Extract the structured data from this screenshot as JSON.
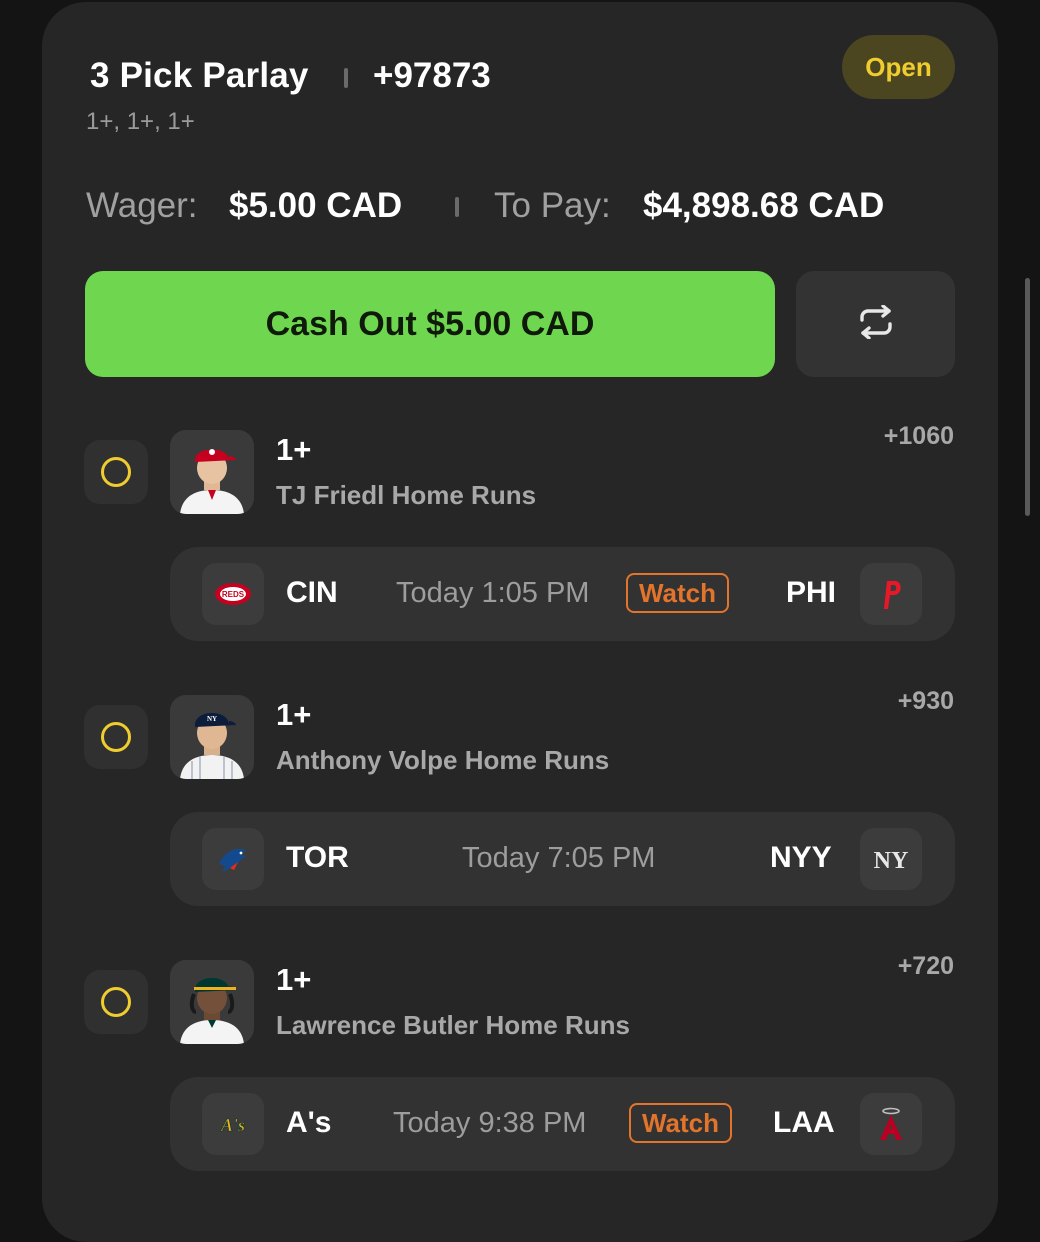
{
  "bet": {
    "title": "3 Pick Parlay",
    "odds": "+97873",
    "subtitle": "1+, 1+, 1+",
    "status": "Open",
    "wager_label": "Wager:",
    "wager_value": "$5.00 CAD",
    "pay_label": "To Pay:",
    "pay_value": "$4,898.68 CAD",
    "cashout_label": "Cash Out $5.00 CAD",
    "refresh_icon": "refresh-icon"
  },
  "picks": [
    {
      "line": "1+",
      "name": "TJ Friedl Home Runs",
      "odds": "+1060",
      "avatar_icon": "player-avatar-icon",
      "game": {
        "away": "CIN",
        "away_logo": "reds-logo-icon",
        "time": "Today 1:05 PM",
        "watch": "Watch",
        "home": "PHI",
        "home_logo": "phillies-logo-icon"
      }
    },
    {
      "line": "1+",
      "name": "Anthony Volpe Home Runs",
      "odds": "+930",
      "avatar_icon": "player-avatar-icon",
      "game": {
        "away": "TOR",
        "away_logo": "blue-jays-logo-icon",
        "time": "Today 7:05 PM",
        "watch": "",
        "home": "NYY",
        "home_logo": "yankees-logo-icon"
      }
    },
    {
      "line": "1+",
      "name": "Lawrence Butler Home Runs",
      "odds": "+720",
      "avatar_icon": "player-avatar-icon",
      "game": {
        "away": "A's",
        "away_logo": "athletics-logo-icon",
        "time": "Today 9:38 PM",
        "watch": "Watch",
        "home": "LAA",
        "home_logo": "angels-logo-icon"
      }
    }
  ],
  "colors": {
    "background": "#141414",
    "card": "#262626",
    "accent_green": "#6fd650",
    "status_yellow": "#f0cd2e",
    "watch_orange": "#e2742b"
  }
}
